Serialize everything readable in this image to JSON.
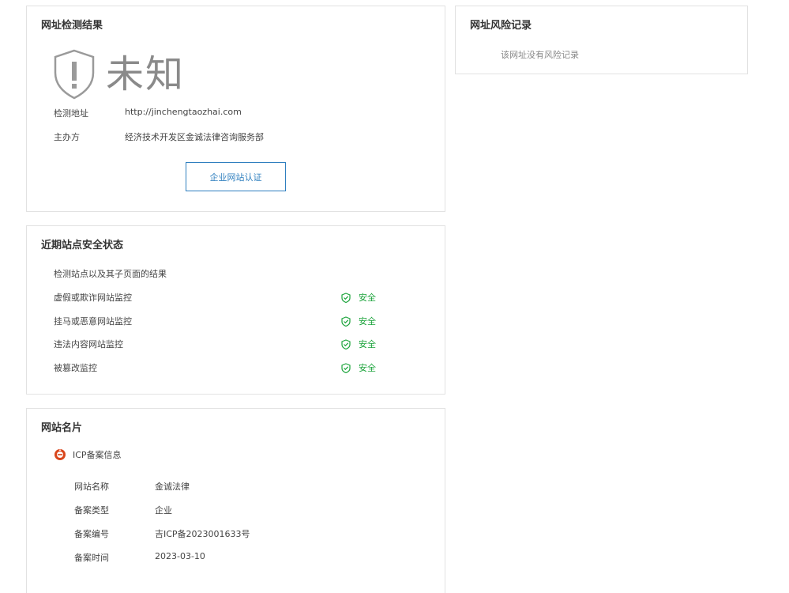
{
  "result": {
    "title": "网址检测结果",
    "status": "未知",
    "rows": [
      {
        "label": "检测地址",
        "value": "http://jinchengtaozhai.com"
      },
      {
        "label": "主办方",
        "value": "经济技术开发区金诚法律咨询服务部"
      }
    ],
    "cert_button": "企业网站认证"
  },
  "recent": {
    "title": "近期站点安全状态",
    "subtitle": "检测站点以及其子页面的结果",
    "items": [
      {
        "label": "虚假或欺诈网站监控",
        "status": "安全"
      },
      {
        "label": "挂马或恶意网站监控",
        "status": "安全"
      },
      {
        "label": "违法内容网站监控",
        "status": "安全"
      },
      {
        "label": "被篡改监控",
        "status": "安全"
      }
    ]
  },
  "site_card": {
    "title": "网站名片",
    "icp_heading": "ICP备案信息",
    "rows": [
      {
        "label": "网站名称",
        "value": "金诚法律"
      },
      {
        "label": "备案类型",
        "value": "企业"
      },
      {
        "label": "备案编号",
        "value": "吉ICP备2023001633号"
      },
      {
        "label": "备案时间",
        "value": "2023-03-10"
      }
    ]
  },
  "risk": {
    "title": "网址风险记录",
    "empty_text": "该网址没有风险记录"
  },
  "colors": {
    "safe": "#1aa33a",
    "link": "#2f7fbf",
    "unknown": "#8a8a8a"
  }
}
